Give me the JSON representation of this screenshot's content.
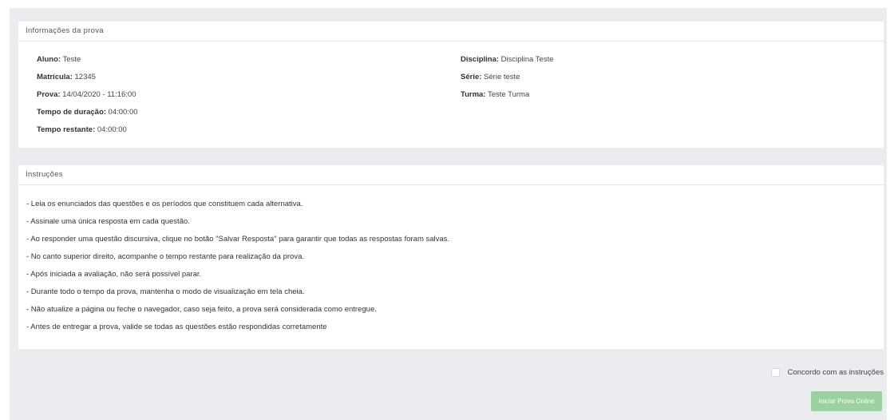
{
  "info": {
    "header": "Informações da prova",
    "left": [
      {
        "label": "Aluno:",
        "value": " Teste"
      },
      {
        "label": "Matrícula:",
        "value": " 12345"
      },
      {
        "label": "Prova:",
        "value": " 14/04/2020 - 11:16:00"
      },
      {
        "label": "Tempo de duração:",
        "value": " 04:00:00"
      },
      {
        "label": "Tempo restante:",
        "value": " 04:00:00"
      }
    ],
    "right": [
      {
        "label": "Disciplina:",
        "value": " Disciplina Teste"
      },
      {
        "label": "Série:",
        "value": " Série teste"
      },
      {
        "label": "Turma:",
        "value": " Teste Turma"
      }
    ]
  },
  "instructions": {
    "header": "Instruções",
    "items": [
      "- Leia os enunciados das questões e os períodos que constituem cada alternativa.",
      "- Assinale uma única resposta em cada questão.",
      "- Ao responder uma questão discursiva, clique no botão \"Salvar Resposta\" para garantir que todas as respostas foram salvas.",
      "- No canto superior direito, acompanhe o tempo restante para realização da prova.",
      "- Após iniciada a avaliação, não será possível parar.",
      "- Durante todo o tempo da prova, mantenha o modo de visualização em tela cheia.",
      "- Não atualize a página ou feche o navegador, caso seja feito, a prova será considerada como entregue.",
      "- Antes de entregar a prova, valide se todas as questões estão respondidas corretamente"
    ]
  },
  "agreement": {
    "label": "Concordo com as instruções",
    "checked": false
  },
  "start_button": {
    "label": "Iniciar Prova Online",
    "color": "#9bd1a0"
  }
}
